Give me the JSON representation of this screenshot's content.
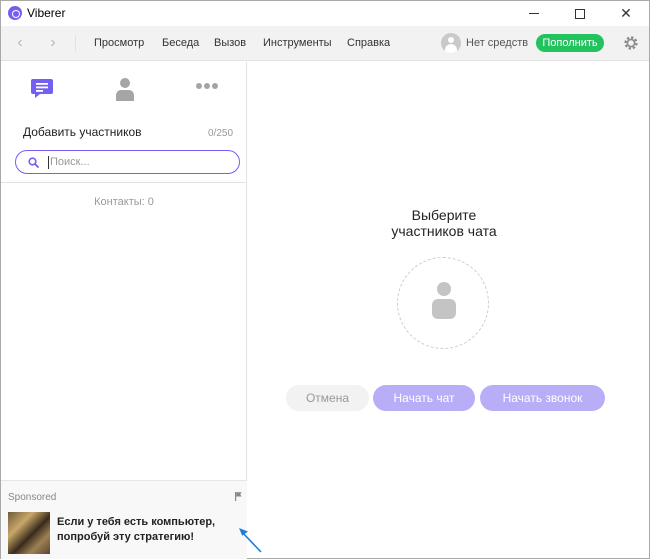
{
  "window": {
    "title": "Viberer",
    "close_glyph": "✕"
  },
  "toolbar": {
    "back_glyph": "‹",
    "forward_glyph": "›",
    "menu": [
      "Просмотр",
      "Беседа",
      "Вызов",
      "Инструменты",
      "Справка"
    ],
    "balance": "Нет средств",
    "topup_label": "Пополнить"
  },
  "left_panel": {
    "add_participants": "Добавить участников",
    "participant_count": "0/250",
    "search_placeholder": "Поиск...",
    "contacts_count": "Контакты: 0"
  },
  "sponsored": {
    "label": "Sponsored",
    "ad_line1": "Если у тебя есть компьютер,",
    "ad_line2": "попробуй эту стратегию!"
  },
  "main": {
    "choose_line1": "Выберите",
    "choose_line2": "участников чата",
    "cancel_label": "Отмена",
    "start_chat_label": "Начать чат",
    "start_call_label": "Начать звонок"
  },
  "colors": {
    "accent": "#7360f2",
    "accent_disabled": "#b8aef8",
    "topup_green": "#22c35e",
    "annotation_arrow": "#1f7fd6"
  },
  "icons": [
    "viber-logo-icon",
    "back-arrow-icon",
    "forward-arrow-icon",
    "avatar-icon",
    "gear-icon",
    "chats-icon",
    "contacts-icon",
    "more-icon",
    "search-icon",
    "flag-icon",
    "person-placeholder-icon",
    "annotation-arrow-icon"
  ]
}
